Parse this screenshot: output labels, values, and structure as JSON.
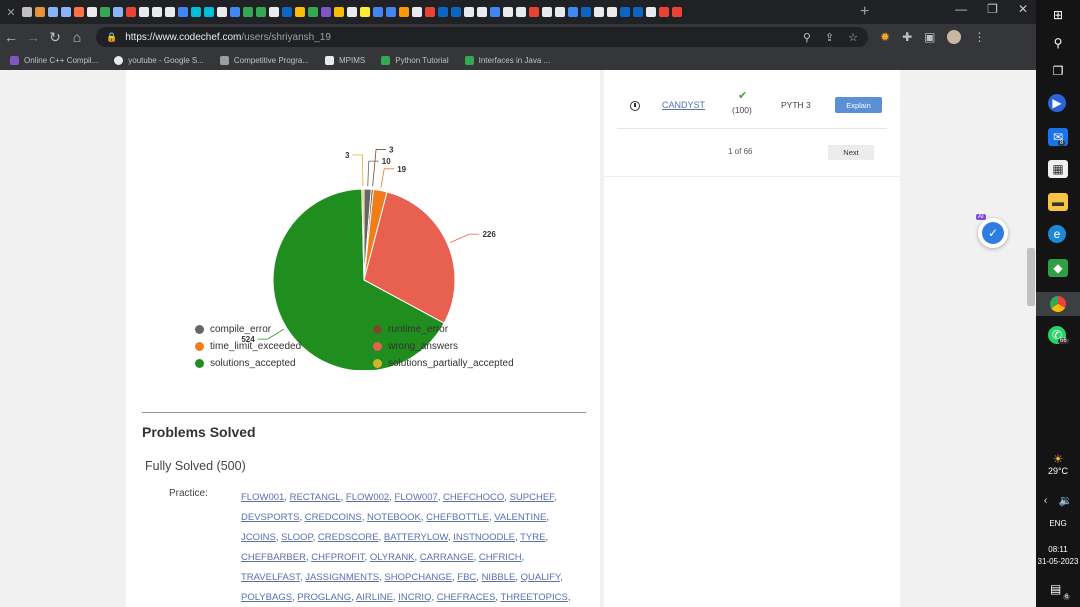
{
  "browser": {
    "url_host": "https://www.codechef.com",
    "url_path": "/users/shriyansh_19",
    "bookmarks": [
      "Online C++ Compil...",
      "youtube - Google S...",
      "Competitive Progra...",
      "MPIMS",
      "Python Tutorial",
      "Interfaces in Java ..."
    ],
    "tab_favicon_colors": [
      "#c0c0c0",
      "#e8913b",
      "#8ab4f8",
      "#8ab4f8",
      "#ff7043",
      "#e8eaed",
      "#34a853",
      "#8ab4f8",
      "#ea4335",
      "#e8eaed",
      "#e8eaed",
      "#e8eaed",
      "#4285f4",
      "#00bcd4",
      "#00bcd4",
      "#e8eaed",
      "#4285f4",
      "#34a853",
      "#34a853",
      "#e8eaed",
      "#0a66c2",
      "#fbbc05",
      "#34a853",
      "#7e57c2",
      "#fbbc05",
      "#e8eaed",
      "#ffeb3b",
      "#4285f4",
      "#4285f4",
      "#ff9800",
      "#e8eaed",
      "#ea4335",
      "#0a66c2",
      "#0a66c2",
      "#e8eaed",
      "#e8eaed",
      "#4285f4",
      "#e8eaed",
      "#e8eaed",
      "#ea4335",
      "#e8eaed",
      "#e8eaed",
      "#4285f4",
      "#0a66c2",
      "#e8eaed",
      "#e8eaed",
      "#0a66c2",
      "#0a66c2",
      "#e8eaed",
      "#ea4335",
      "#ea4335"
    ]
  },
  "chart_data": {
    "type": "pie",
    "slices": [
      {
        "label": "compile_error",
        "value": 10,
        "color": "#666666"
      },
      {
        "label": "runtime_error",
        "value": 3,
        "color": "#7a4a2a"
      },
      {
        "label": "time_limit_exceeded",
        "value": 19,
        "color": "#f07d1a"
      },
      {
        "label": "wrong_answers",
        "value": 226,
        "color": "#e8604f"
      },
      {
        "label": "solutions_accepted",
        "value": 524,
        "color": "#1f8e1f"
      },
      {
        "label": "solutions_partially_accepted",
        "value": 3,
        "color": "#d4b62a"
      }
    ],
    "legend": [
      "compile_error",
      "runtime_error",
      "time_limit_exceeded",
      "wrong_answers",
      "solutions_accepted",
      "solutions_partially_accepted"
    ],
    "legend_position": "bottom"
  },
  "problems": {
    "heading": "Problems Solved",
    "fully_solved": "Fully Solved (500)",
    "practice_label": "Practice:",
    "links": [
      "FLOW001",
      "RECTANGL",
      "FLOW002",
      "FLOW007",
      "CHEFCHOCO",
      "SUPCHEF",
      "DEVSPORTS",
      "CREDCOINS",
      "NOTEBOOK",
      "CHEFBOTTLE",
      "VALENTINE",
      "JCOINS",
      "SLOOP",
      "CREDSCORE",
      "BATTERYLOW",
      "INSTNOODLE",
      "TYRE",
      "CHEFBARBER",
      "CHFPROFIT",
      "OLYRANK",
      "CARRANGE",
      "CHFRICH",
      "TRAVELFAST",
      "JASSIGNMENTS",
      "SHOPCHANGE",
      "FBC",
      "NIBBLE",
      "QUALIFY",
      "POLYBAGS",
      "PROGLANG",
      "AIRLINE",
      "INCRIQ",
      "CHEFRACES",
      "THREETOPICS"
    ]
  },
  "submission": {
    "problem": "CANDYST",
    "score": "(100)",
    "language": "PYTH 3",
    "explain_label": "Explain",
    "pager": "1 of 66",
    "next_label": "Next"
  },
  "widget": {
    "badge": "AI"
  },
  "taskbar": {
    "mail_badge": "8",
    "whatsapp_badge": "66",
    "temperature": "29°C",
    "lang": "ENG",
    "time": "08:11",
    "date": "31-05-2023",
    "notif_badge": "6"
  }
}
